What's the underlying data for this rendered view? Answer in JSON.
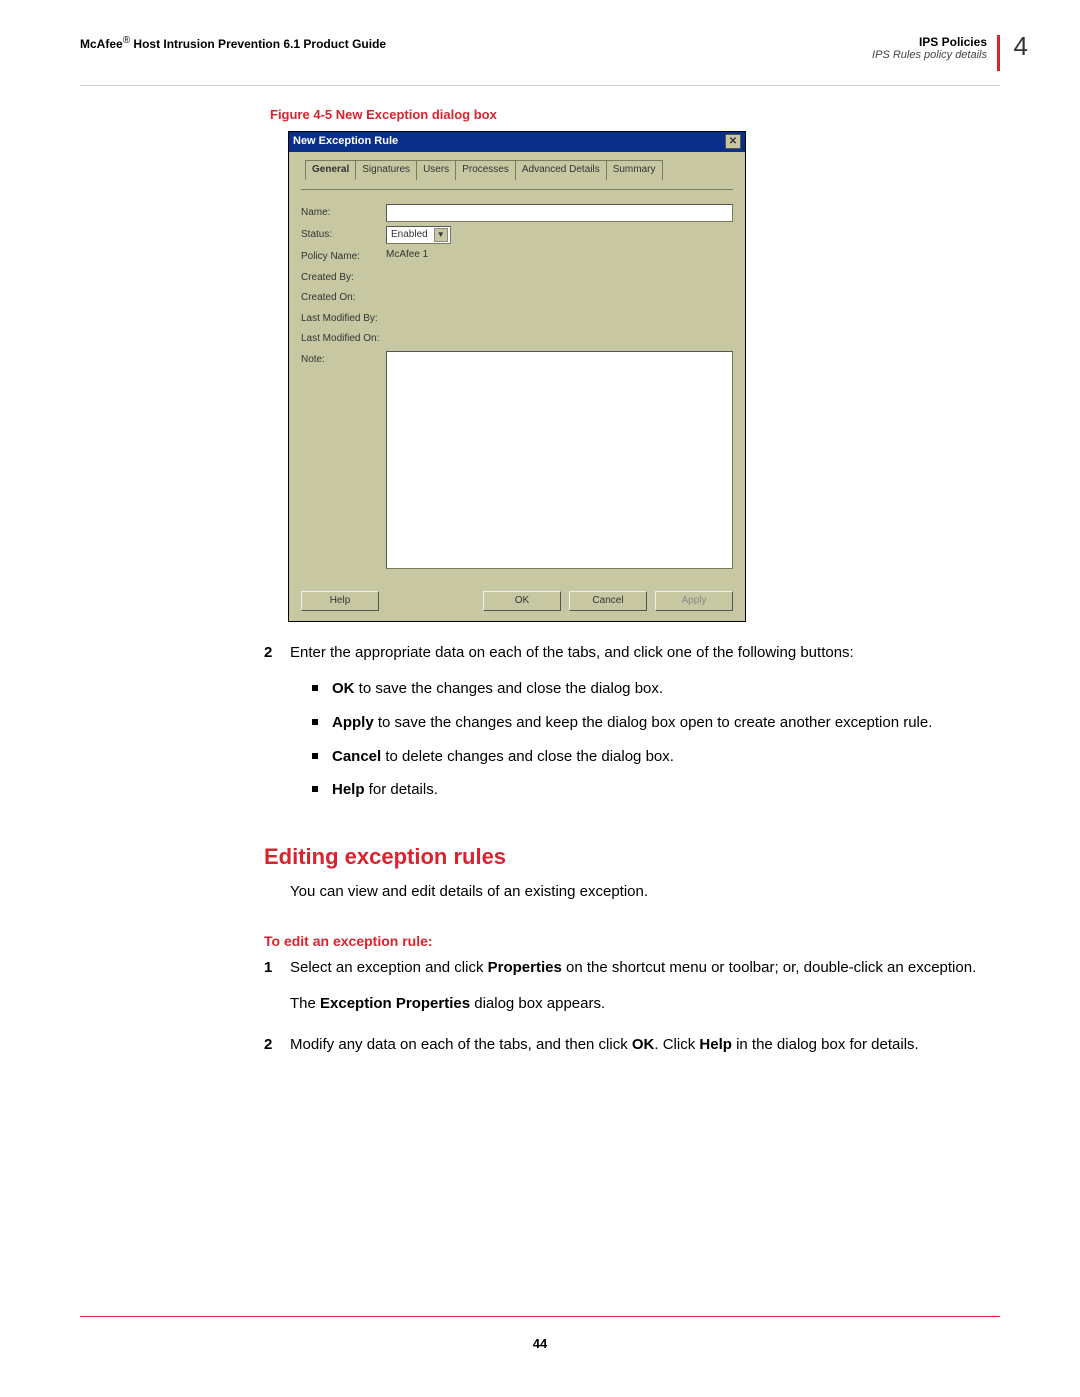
{
  "header": {
    "brand": "McAfee",
    "sup": "®",
    "title": " Host Intrusion Prevention 6.1 Product Guide",
    "section": "IPS Policies",
    "subsection": "IPS Rules policy details",
    "chapter": "4"
  },
  "figure_caption": "Figure 4-5  New Exception dialog box",
  "dialog": {
    "title": "New Exception Rule",
    "tabs": [
      "General",
      "Signatures",
      "Users",
      "Processes",
      "Advanced Details",
      "Summary"
    ],
    "labels": {
      "name": "Name:",
      "status": "Status:",
      "policy": "Policy Name:",
      "created_by": "Created By:",
      "created_on": "Created On:",
      "modified_by": "Last Modified By:",
      "modified_on": "Last Modified On:",
      "note": "Note:"
    },
    "status_value": "Enabled",
    "policy_value": "McAfee 1",
    "buttons": {
      "help": "Help",
      "ok": "OK",
      "cancel": "Cancel",
      "apply": "Apply"
    }
  },
  "step2": {
    "num": "2",
    "text": "Enter the appropriate data on each of the tabs, and click one of the following buttons:"
  },
  "bullets": {
    "ok": {
      "b": "OK",
      "t": " to save the changes and close the dialog box."
    },
    "apply": {
      "b": "Apply",
      "t": " to save the changes and keep the dialog box open to create another exception rule."
    },
    "cancel": {
      "b": "Cancel",
      "t": " to delete changes and close the dialog box."
    },
    "help": {
      "b": "Help",
      "t": " for details."
    }
  },
  "h2": "Editing exception rules",
  "h2_intro": "You can view and edit details of an existing exception.",
  "sub_red": "To edit an exception rule:",
  "edit_step1": {
    "num": "1",
    "t1": "Select an exception and click ",
    "b1": "Properties",
    "t2": " on the shortcut menu or toolbar; or, double-click an exception."
  },
  "edit_step1_after": {
    "t1": "The ",
    "b1": "Exception Properties",
    "t2": " dialog box appears."
  },
  "edit_step2": {
    "num": "2",
    "t1": "Modify any data on each of the tabs, and then click ",
    "b1": "OK",
    "t2": ". Click ",
    "b2": "Help",
    "t3": " in the dialog box for details."
  },
  "page_number": "44"
}
